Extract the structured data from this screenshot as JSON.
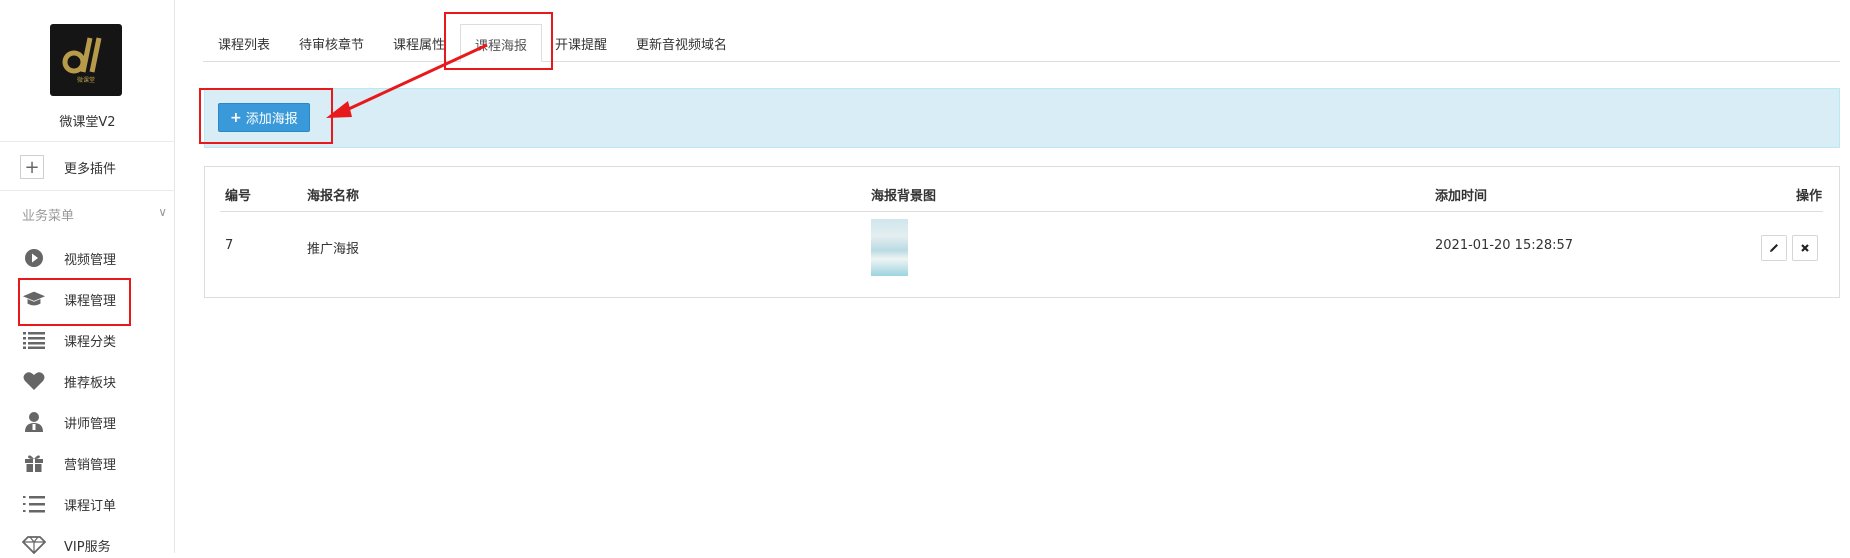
{
  "sidebar": {
    "logo_text": "微课堂",
    "app_name": "微课堂V2",
    "more_plugins": "更多插件",
    "section_title": "业务菜单",
    "items": [
      {
        "label": "视频管理",
        "icon": "play-icon"
      },
      {
        "label": "课程管理",
        "icon": "graduation-cap-icon"
      },
      {
        "label": "课程分类",
        "icon": "list-icon"
      },
      {
        "label": "推荐板块",
        "icon": "heart-icon"
      },
      {
        "label": "讲师管理",
        "icon": "teacher-icon"
      },
      {
        "label": "营销管理",
        "icon": "gift-icon"
      },
      {
        "label": "课程订单",
        "icon": "ordered-list-icon"
      },
      {
        "label": "VIP服务",
        "icon": "diamond-icon"
      }
    ]
  },
  "tabs": [
    {
      "label": "课程列表"
    },
    {
      "label": "待审核章节"
    },
    {
      "label": "课程属性"
    },
    {
      "label": "课程海报",
      "active": true
    },
    {
      "label": "开课提醒"
    },
    {
      "label": "更新音视频域名"
    }
  ],
  "toolbar": {
    "add_label": "添加海报"
  },
  "table": {
    "headers": [
      "编号",
      "海报名称",
      "海报背景图",
      "添加时间",
      "操作"
    ],
    "rows": [
      {
        "id": "7",
        "name": "推广海报",
        "added": "2021-01-20 15:28:57"
      }
    ]
  },
  "colors": {
    "highlight": "#e8191a",
    "primary": "#3a9ad9",
    "alert_bg": "#d9edf7"
  }
}
